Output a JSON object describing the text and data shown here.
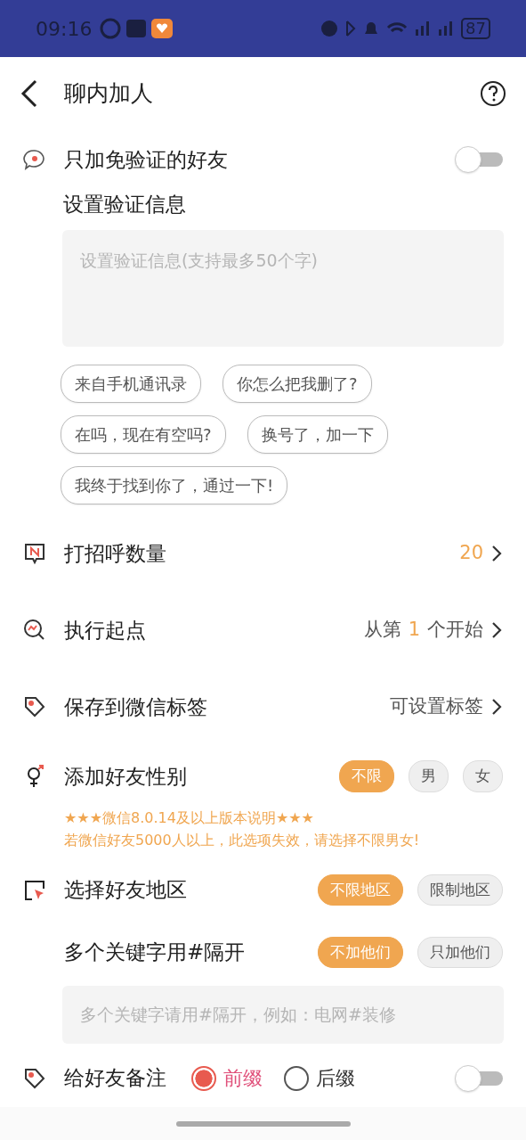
{
  "status_bar": {
    "time": "09:16",
    "battery": "87"
  },
  "header": {
    "title": "聊内加人"
  },
  "verify_only": {
    "label": "只加免验证的好友",
    "on": false
  },
  "verify_message": {
    "label": "设置验证信息",
    "placeholder": "设置验证信息(支持最多50个字)"
  },
  "chips": [
    "来自手机通讯录",
    "你怎么把我删了?",
    "在吗，现在有空吗?",
    "换号了，加一下",
    "我终于找到你了，通过一下!"
  ],
  "settings": [
    {
      "kind": "greet",
      "label": "打招呼数量",
      "value": [
        {
          "text": "20",
          "highlight": true
        }
      ]
    },
    {
      "kind": "start",
      "label": "执行起点",
      "value": [
        {
          "text": "从第",
          "highlight": false
        },
        {
          "text": "1",
          "highlight": true
        },
        {
          "text": "个开始",
          "highlight": false
        }
      ]
    },
    {
      "kind": "tag",
      "label": "保存到微信标签",
      "value": [
        {
          "text": "可设置标签",
          "highlight": false
        }
      ]
    }
  ],
  "gender": {
    "label": "添加好友性别",
    "options": [
      {
        "label": "不限",
        "selected": true
      },
      {
        "label": "男",
        "selected": false
      },
      {
        "label": "女",
        "selected": false
      }
    ],
    "notes": [
      "★★★微信8.0.14及以上版本说明★★★",
      "若微信好友5000人以上，此选项失效，请选择不限男女!"
    ]
  },
  "region": {
    "label": "选择好友地区",
    "options": [
      {
        "label": "不限地区",
        "selected": true
      },
      {
        "label": "限制地区",
        "selected": false
      }
    ]
  },
  "keywords": {
    "label": "多个关键字用#隔开",
    "options": [
      {
        "label": "不加他们",
        "selected": true
      },
      {
        "label": "只加他们",
        "selected": false
      }
    ],
    "placeholder": "多个关键字请用#隔开，例如：电网#装修"
  },
  "remark": {
    "label": "给好友备注",
    "options": [
      {
        "label": "前缀",
        "selected": true
      },
      {
        "label": "后缀",
        "selected": false
      }
    ],
    "on": false
  }
}
